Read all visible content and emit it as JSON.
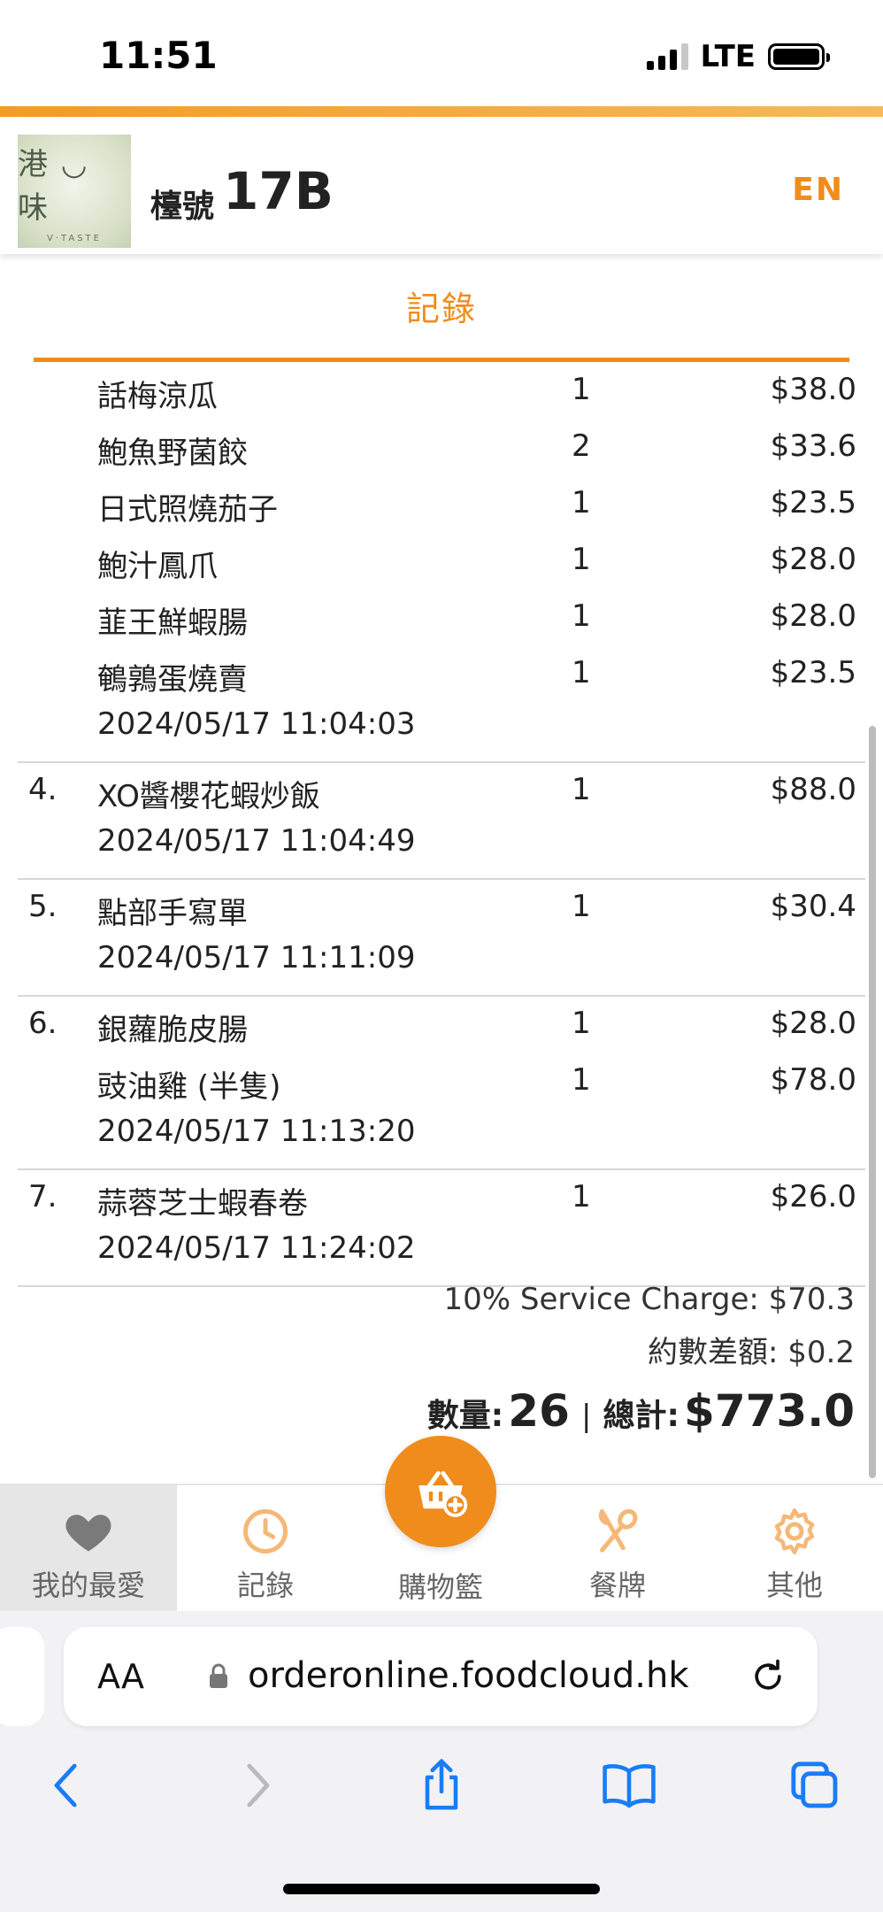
{
  "status": {
    "time": "11:51",
    "network": "LTE"
  },
  "header": {
    "logo_main": "港 ◡ 味",
    "logo_sub": "V·TASTE",
    "table_label": "檯號",
    "table_number": "17B",
    "lang_toggle": "EN"
  },
  "section_title": "記錄",
  "orders": [
    {
      "num": "",
      "items": [
        {
          "name": "話梅涼瓜",
          "qty": "1",
          "price": "$38.0"
        },
        {
          "name": "鮑魚野菌餃",
          "qty": "2",
          "price": "$33.6"
        },
        {
          "name": "日式照燒茄子",
          "qty": "1",
          "price": "$23.5"
        },
        {
          "name": "鮑汁鳳爪",
          "qty": "1",
          "price": "$28.0"
        },
        {
          "name": "韮王鮮蝦腸",
          "qty": "1",
          "price": "$28.0"
        },
        {
          "name": "鵪鶉蛋燒賣",
          "qty": "1",
          "price": "$23.5"
        }
      ],
      "time": "2024/05/17 11:04:03"
    },
    {
      "num": "4.",
      "items": [
        {
          "name": "XO醬櫻花蝦炒飯",
          "qty": "1",
          "price": "$88.0"
        }
      ],
      "time": "2024/05/17 11:04:49"
    },
    {
      "num": "5.",
      "items": [
        {
          "name": "點部手寫單",
          "qty": "1",
          "price": "$30.4"
        }
      ],
      "time": "2024/05/17 11:11:09"
    },
    {
      "num": "6.",
      "items": [
        {
          "name": "銀蘿脆皮腸",
          "qty": "1",
          "price": "$28.0"
        },
        {
          "name": "豉油雞 (半隻)",
          "qty": "1",
          "price": "$78.0"
        }
      ],
      "time": "2024/05/17 11:13:20"
    },
    {
      "num": "7.",
      "items": [
        {
          "name": "蒜蓉芝士蝦春卷",
          "qty": "1",
          "price": "$26.0"
        }
      ],
      "time": "2024/05/17 11:24:02"
    }
  ],
  "summary": {
    "service_charge": "10% Service Charge: $70.3",
    "rounding": "約數差額: $0.2",
    "qty_label": "數量:",
    "qty_value": "26",
    "separator": "|",
    "total_label": "總計:",
    "total_value": "$773.0"
  },
  "tabs": {
    "favorites": "我的最愛",
    "history": "記錄",
    "cart": "購物籃",
    "menu": "餐牌",
    "other": "其他"
  },
  "browser": {
    "aa_label": "AA",
    "url": "orderonline.foodcloud.hk"
  },
  "colors": {
    "accent": "#f08c1c",
    "active_tab_bg": "#e6e6e6",
    "inactive_icon": "#f5b878"
  }
}
